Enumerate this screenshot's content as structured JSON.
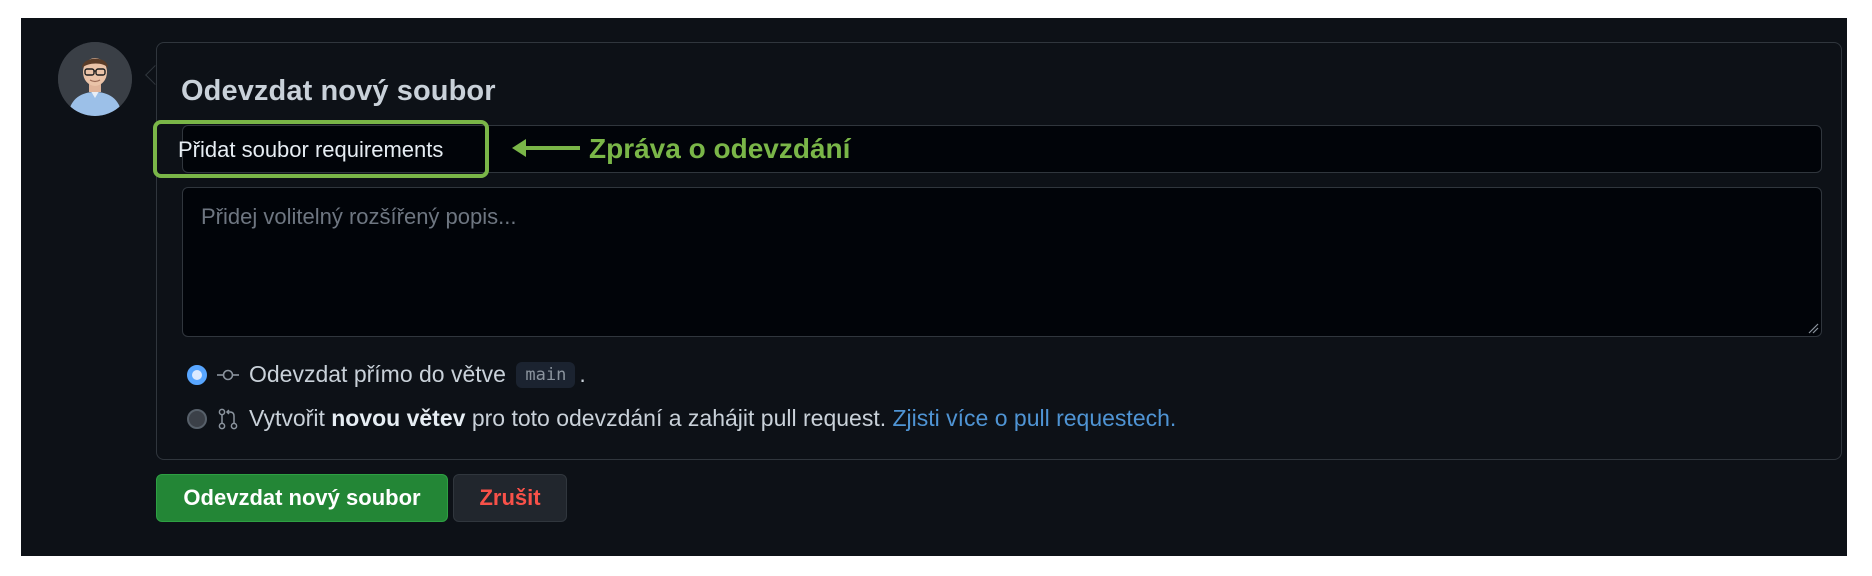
{
  "form": {
    "title": "Odevzdat nový soubor",
    "commit_message_value": "Přidat soubor requirements",
    "description_placeholder": "Přidej volitelný rozšířený popis..."
  },
  "annotation": {
    "label": "Zpráva o odevzdání",
    "color": "#7ab648"
  },
  "options": {
    "direct": {
      "text_before": "Odevzdat přímo do větve",
      "branch": "main",
      "text_after": ".",
      "selected": true,
      "icon": "git-commit-icon"
    },
    "new_branch": {
      "text_before": "Vytvořit",
      "bold": "novou větev",
      "text_after": "pro toto odevzdání a zahájit pull request.",
      "link": "Zjisti více o pull requestech.",
      "selected": false,
      "icon": "git-pull-request-icon"
    }
  },
  "buttons": {
    "commit": "Odevzdat nový soubor",
    "cancel": "Zrušit"
  },
  "colors": {
    "background": "#0d1117",
    "accent_green": "#238636",
    "link": "#4f94d4",
    "danger": "#f85149"
  }
}
